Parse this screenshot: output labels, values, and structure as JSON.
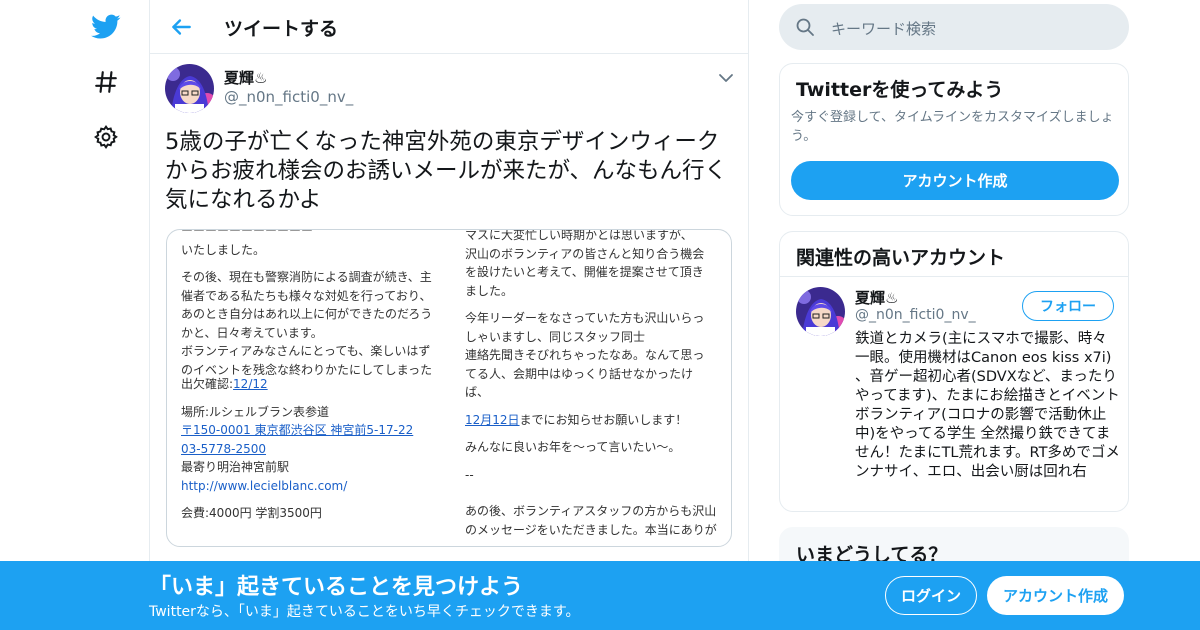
{
  "header": {
    "title": "ツイートする"
  },
  "tweet": {
    "author_name": "夏輝♨",
    "author_handle": "@_n0n_ficti0_nv_",
    "text": "5歳の子が亡くなった神宮外苑の東京デザインウィークからお疲れ様会のお誘いメールが来たが、んなもん行く気になれるかよ"
  },
  "media": {
    "left": {
      "line0": "いたしました。",
      "line1": "その後、現在も警察消防による調査が続き、主",
      "line2": "催者である私たちも様々な対処を行っており、",
      "line3": "あのとき自分はあれ以上に何ができたのだろう",
      "line4": "かと、日々考えています。",
      "line5": "ボランティアみなさんにとっても、楽しいはず",
      "line6": "のイベントを残念な終わりかたにしてしまった",
      "rsvp_label": "出欠確認:",
      "rsvp_date": "12/12",
      "venue": "場所:ルシェルブラン表参道",
      "address": "〒150-0001 東京都渋谷区 神宮前5-17-22",
      "phone": "03-5778-2500",
      "station": "最寄り明治神宮前駅",
      "url": "http://www.lecielblanc.com/",
      "fee": "会費:4000円 学割3500円"
    },
    "right": {
      "line1": "マスに大変忙しい時期かとは思いますが、",
      "line2": "沢山のボランティアの皆さんと知り合う機会",
      "line3": "を設けたいと考えて、開催を提案させて頂き",
      "line4": "ました。",
      "line5": "今年リーダーをなさっていた方も沢山いらっ",
      "line6": "しゃいますし、同じスタッフ同士",
      "line7": "連絡先聞きそびれちゃったなあ。なんて思っ",
      "line8": "てる人、会期中はゆっくり話せなかったけ",
      "line9": "ば、",
      "deadline_date": "12月12日",
      "deadline_text": "までにお知らせお願いします！",
      "line10": "みんなに良いお年を〜って言いたい〜。",
      "line11": "--",
      "line12": "あの後、ボランティアスタッフの方からも沢山",
      "line13": "のメッセージをいただきました。本当にありが"
    }
  },
  "search": {
    "placeholder": "キーワード検索"
  },
  "try_card": {
    "title": "Twitterを使ってみよう",
    "desc": "今すぐ登録して、タイムラインをカスタマイズしましょう。",
    "button": "アカウント作成"
  },
  "related": {
    "title": "関連性の高いアカウント",
    "name": "夏輝♨",
    "handle": "@_n0n_ficti0_nv_",
    "follow": "フォロー",
    "bio": "鉄道とカメラ(主にスマホで撮影、時々一眼。使用機材はCanon eos kiss x7i) 、音ゲー超初心者(SDVXなど、まったりやってます)、たまにお絵描きとイベントボランティア(コロナの影響で活動休止中)をやってる学生 全然撮り鉄できてません！たまにTL荒れます。RT多めでゴメンナサイ、エロ、出会い厨は回れ右"
  },
  "whats_happening": {
    "title": "いまどうしてる？"
  },
  "banner": {
    "title": "「いま」起きていることを見つけよう",
    "subtitle": "Twitterなら、「いま」起きていることをいち早くチェックできます。",
    "login": "ログイン",
    "signup": "アカウント作成"
  },
  "colors": {
    "accent": "#1da1f2",
    "border": "#e6ecf0",
    "muted": "#657786"
  }
}
